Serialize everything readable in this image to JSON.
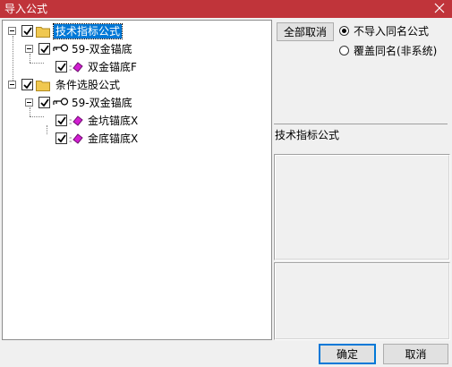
{
  "window": {
    "title": "导入公式"
  },
  "tree": {
    "nodes": [
      {
        "label": "技术指标公式",
        "checked": true,
        "selected": true
      },
      {
        "label": "59-双金锚底",
        "checked": true
      },
      {
        "label": "双金锚底F",
        "checked": true
      },
      {
        "label": "条件选股公式",
        "checked": true
      },
      {
        "label": "59-双金锚底",
        "checked": true
      },
      {
        "label": "金坑锚底X",
        "checked": true
      },
      {
        "label": "金底锚底X",
        "checked": true
      }
    ]
  },
  "options": {
    "deselect_all_label": "全部取消",
    "radio_skip_label": "不导入同名公式",
    "radio_overwrite_label": "覆盖同名(非系统)",
    "selected_option": "skip"
  },
  "detail": {
    "name": "技术指标公式"
  },
  "buttons": {
    "ok_label": "确定",
    "cancel_label": "取消"
  },
  "colors": {
    "title_bar": "#c0343a",
    "selection": "#0078d7",
    "leaf_icon": "#d21ed2",
    "folder": "#f0c850"
  }
}
